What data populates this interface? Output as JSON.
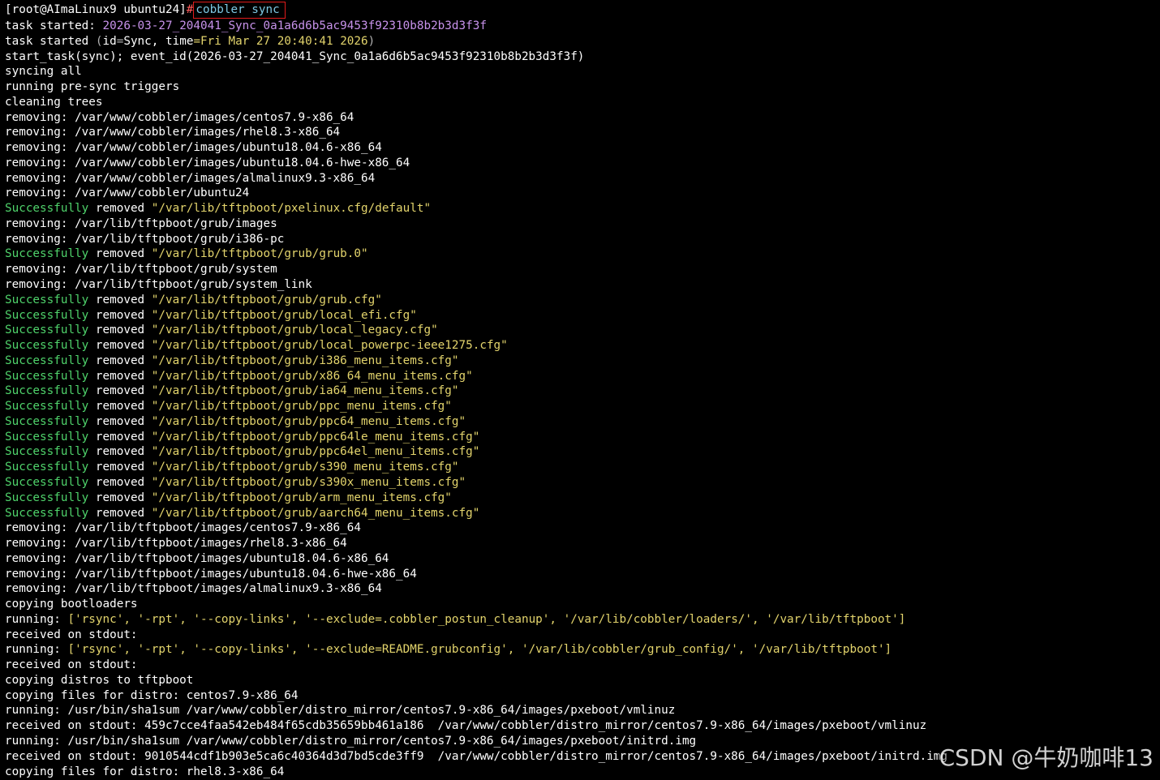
{
  "prompt": {
    "user_host_dir": "[root@AImaLinux9 ubuntu24]",
    "symbol": "#",
    "command": "cobbler sync"
  },
  "task_started": {
    "label": "task started: ",
    "value": "2026-03-27_204041_Sync_0a1a6d6b5ac9453f92310b8b2b3d3f3f"
  },
  "task_started_id": {
    "prefix": "task started ",
    "open": "(",
    "id_key": "id",
    "eq1": "=",
    "id_val": "Sync",
    "sep": ", ",
    "time_key": "time",
    "eq2": "=",
    "time_val": "Fri Mar 27 20:40:41 2026",
    "close": ")"
  },
  "start_task": "start_task(sync); event_id(2026-03-27_204041_Sync_0a1a6d6b5ac9453f92310b8b2b3d3f3f)",
  "lines_a": [
    "syncing all",
    "running pre-sync triggers",
    "cleaning trees"
  ],
  "removing_label": "removing:",
  "success_word": "Successfully",
  "removed_word": "removed",
  "removing_1": [
    "/var/www/cobbler/images/centos7.9-x86_64",
    "/var/www/cobbler/images/rhel8.3-x86_64",
    "/var/www/cobbler/images/ubuntu18.04.6-x86_64",
    "/var/www/cobbler/images/ubuntu18.04.6-hwe-x86_64",
    "/var/www/cobbler/images/almalinux9.3-x86_64",
    "/var/www/cobbler/ubuntu24"
  ],
  "success_1": "\"/var/lib/tftpboot/pxelinux.cfg/default\"",
  "removing_2": [
    "/var/lib/tftpboot/grub/images",
    "/var/lib/tftpboot/grub/i386-pc"
  ],
  "success_2": "\"/var/lib/tftpboot/grub/grub.0\"",
  "removing_3": [
    "/var/lib/tftpboot/grub/system",
    "/var/lib/tftpboot/grub/system_link"
  ],
  "success_3": [
    "\"/var/lib/tftpboot/grub/grub.cfg\"",
    "\"/var/lib/tftpboot/grub/local_efi.cfg\"",
    "\"/var/lib/tftpboot/grub/local_legacy.cfg\"",
    "\"/var/lib/tftpboot/grub/local_powerpc-ieee1275.cfg\"",
    "\"/var/lib/tftpboot/grub/i386_menu_items.cfg\"",
    "\"/var/lib/tftpboot/grub/x86_64_menu_items.cfg\"",
    "\"/var/lib/tftpboot/grub/ia64_menu_items.cfg\"",
    "\"/var/lib/tftpboot/grub/ppc_menu_items.cfg\"",
    "\"/var/lib/tftpboot/grub/ppc64_menu_items.cfg\"",
    "\"/var/lib/tftpboot/grub/ppc64le_menu_items.cfg\"",
    "\"/var/lib/tftpboot/grub/ppc64el_menu_items.cfg\"",
    "\"/var/lib/tftpboot/grub/s390_menu_items.cfg\"",
    "\"/var/lib/tftpboot/grub/s390x_menu_items.cfg\"",
    "\"/var/lib/tftpboot/grub/arm_menu_items.cfg\"",
    "\"/var/lib/tftpboot/grub/aarch64_menu_items.cfg\""
  ],
  "removing_4": [
    "/var/lib/tftpboot/images/centos7.9-x86_64",
    "/var/lib/tftpboot/images/rhel8.3-x86_64",
    "/var/lib/tftpboot/images/ubuntu18.04.6-x86_64",
    "/var/lib/tftpboot/images/ubuntu18.04.6-hwe-x86_64",
    "/var/lib/tftpboot/images/almalinux9.3-x86_64"
  ],
  "copying_bootloaders": "copying bootloaders",
  "running_label": "running:",
  "running_rsync_1": "['rsync', '-rpt', '--copy-links', '--exclude=.cobbler_postun_cleanup', '/var/lib/cobbler/loaders/', '/var/lib/tftpboot']",
  "received_label": "received on stdout:",
  "running_rsync_2": "['rsync', '-rpt', '--copy-links', '--exclude=README.grubconfig', '/var/lib/cobbler/grub_config/', '/var/lib/tftpboot']",
  "copying_distros": "copying distros to tftpboot",
  "copying_files_label": "copying files for distro:",
  "distro_1": "centos7.9-x86_64",
  "running_sha_1": "/usr/bin/sha1sum /var/www/cobbler/distro_mirror/centos7.9-x86_64/images/pxeboot/vmlinuz",
  "received_sha_1": "459c7cce4faa542eb484f65cdb35659bb461a186  /var/www/cobbler/distro_mirror/centos7.9-x86_64/images/pxeboot/vmlinuz",
  "running_sha_2": "/usr/bin/sha1sum /var/www/cobbler/distro_mirror/centos7.9-x86_64/images/pxeboot/initrd.img",
  "received_sha_2": "9010544cdf1b903e5ca6c40364d3d7bd5cde3ff9  /var/www/cobbler/distro_mirror/centos7.9-x86_64/images/pxeboot/initrd.img",
  "distro_2": "rhel8.3-x86_64",
  "watermark": "CSDN @牛奶咖啡13"
}
